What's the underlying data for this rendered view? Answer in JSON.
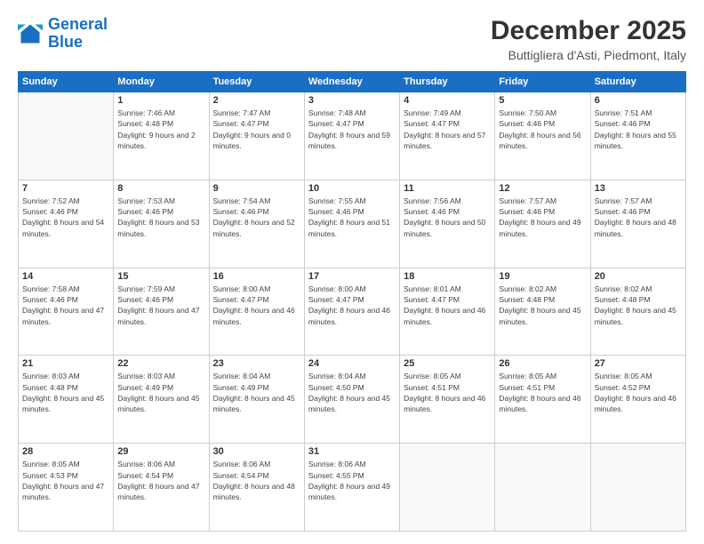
{
  "logo": {
    "line1": "General",
    "line2": "Blue"
  },
  "title": "December 2025",
  "subtitle": "Buttigliera d'Asti, Piedmont, Italy",
  "weekdays": [
    "Sunday",
    "Monday",
    "Tuesday",
    "Wednesday",
    "Thursday",
    "Friday",
    "Saturday"
  ],
  "weeks": [
    [
      {
        "day": "",
        "sunrise": "",
        "sunset": "",
        "daylight": ""
      },
      {
        "day": "1",
        "sunrise": "Sunrise: 7:46 AM",
        "sunset": "Sunset: 4:48 PM",
        "daylight": "Daylight: 9 hours and 2 minutes."
      },
      {
        "day": "2",
        "sunrise": "Sunrise: 7:47 AM",
        "sunset": "Sunset: 4:47 PM",
        "daylight": "Daylight: 9 hours and 0 minutes."
      },
      {
        "day": "3",
        "sunrise": "Sunrise: 7:48 AM",
        "sunset": "Sunset: 4:47 PM",
        "daylight": "Daylight: 8 hours and 59 minutes."
      },
      {
        "day": "4",
        "sunrise": "Sunrise: 7:49 AM",
        "sunset": "Sunset: 4:47 PM",
        "daylight": "Daylight: 8 hours and 57 minutes."
      },
      {
        "day": "5",
        "sunrise": "Sunrise: 7:50 AM",
        "sunset": "Sunset: 4:46 PM",
        "daylight": "Daylight: 8 hours and 56 minutes."
      },
      {
        "day": "6",
        "sunrise": "Sunrise: 7:51 AM",
        "sunset": "Sunset: 4:46 PM",
        "daylight": "Daylight: 8 hours and 55 minutes."
      }
    ],
    [
      {
        "day": "7",
        "sunrise": "Sunrise: 7:52 AM",
        "sunset": "Sunset: 4:46 PM",
        "daylight": "Daylight: 8 hours and 54 minutes."
      },
      {
        "day": "8",
        "sunrise": "Sunrise: 7:53 AM",
        "sunset": "Sunset: 4:46 PM",
        "daylight": "Daylight: 8 hours and 53 minutes."
      },
      {
        "day": "9",
        "sunrise": "Sunrise: 7:54 AM",
        "sunset": "Sunset: 4:46 PM",
        "daylight": "Daylight: 8 hours and 52 minutes."
      },
      {
        "day": "10",
        "sunrise": "Sunrise: 7:55 AM",
        "sunset": "Sunset: 4:46 PM",
        "daylight": "Daylight: 8 hours and 51 minutes."
      },
      {
        "day": "11",
        "sunrise": "Sunrise: 7:56 AM",
        "sunset": "Sunset: 4:46 PM",
        "daylight": "Daylight: 8 hours and 50 minutes."
      },
      {
        "day": "12",
        "sunrise": "Sunrise: 7:57 AM",
        "sunset": "Sunset: 4:46 PM",
        "daylight": "Daylight: 8 hours and 49 minutes."
      },
      {
        "day": "13",
        "sunrise": "Sunrise: 7:57 AM",
        "sunset": "Sunset: 4:46 PM",
        "daylight": "Daylight: 8 hours and 48 minutes."
      }
    ],
    [
      {
        "day": "14",
        "sunrise": "Sunrise: 7:58 AM",
        "sunset": "Sunset: 4:46 PM",
        "daylight": "Daylight: 8 hours and 47 minutes."
      },
      {
        "day": "15",
        "sunrise": "Sunrise: 7:59 AM",
        "sunset": "Sunset: 4:46 PM",
        "daylight": "Daylight: 8 hours and 47 minutes."
      },
      {
        "day": "16",
        "sunrise": "Sunrise: 8:00 AM",
        "sunset": "Sunset: 4:47 PM",
        "daylight": "Daylight: 8 hours and 46 minutes."
      },
      {
        "day": "17",
        "sunrise": "Sunrise: 8:00 AM",
        "sunset": "Sunset: 4:47 PM",
        "daylight": "Daylight: 8 hours and 46 minutes."
      },
      {
        "day": "18",
        "sunrise": "Sunrise: 8:01 AM",
        "sunset": "Sunset: 4:47 PM",
        "daylight": "Daylight: 8 hours and 46 minutes."
      },
      {
        "day": "19",
        "sunrise": "Sunrise: 8:02 AM",
        "sunset": "Sunset: 4:48 PM",
        "daylight": "Daylight: 8 hours and 45 minutes."
      },
      {
        "day": "20",
        "sunrise": "Sunrise: 8:02 AM",
        "sunset": "Sunset: 4:48 PM",
        "daylight": "Daylight: 8 hours and 45 minutes."
      }
    ],
    [
      {
        "day": "21",
        "sunrise": "Sunrise: 8:03 AM",
        "sunset": "Sunset: 4:48 PM",
        "daylight": "Daylight: 8 hours and 45 minutes."
      },
      {
        "day": "22",
        "sunrise": "Sunrise: 8:03 AM",
        "sunset": "Sunset: 4:49 PM",
        "daylight": "Daylight: 8 hours and 45 minutes."
      },
      {
        "day": "23",
        "sunrise": "Sunrise: 8:04 AM",
        "sunset": "Sunset: 4:49 PM",
        "daylight": "Daylight: 8 hours and 45 minutes."
      },
      {
        "day": "24",
        "sunrise": "Sunrise: 8:04 AM",
        "sunset": "Sunset: 4:50 PM",
        "daylight": "Daylight: 8 hours and 45 minutes."
      },
      {
        "day": "25",
        "sunrise": "Sunrise: 8:05 AM",
        "sunset": "Sunset: 4:51 PM",
        "daylight": "Daylight: 8 hours and 46 minutes."
      },
      {
        "day": "26",
        "sunrise": "Sunrise: 8:05 AM",
        "sunset": "Sunset: 4:51 PM",
        "daylight": "Daylight: 8 hours and 46 minutes."
      },
      {
        "day": "27",
        "sunrise": "Sunrise: 8:05 AM",
        "sunset": "Sunset: 4:52 PM",
        "daylight": "Daylight: 8 hours and 46 minutes."
      }
    ],
    [
      {
        "day": "28",
        "sunrise": "Sunrise: 8:05 AM",
        "sunset": "Sunset: 4:53 PM",
        "daylight": "Daylight: 8 hours and 47 minutes."
      },
      {
        "day": "29",
        "sunrise": "Sunrise: 8:06 AM",
        "sunset": "Sunset: 4:54 PM",
        "daylight": "Daylight: 8 hours and 47 minutes."
      },
      {
        "day": "30",
        "sunrise": "Sunrise: 8:06 AM",
        "sunset": "Sunset: 4:54 PM",
        "daylight": "Daylight: 8 hours and 48 minutes."
      },
      {
        "day": "31",
        "sunrise": "Sunrise: 8:06 AM",
        "sunset": "Sunset: 4:55 PM",
        "daylight": "Daylight: 8 hours and 49 minutes."
      },
      {
        "day": "",
        "sunrise": "",
        "sunset": "",
        "daylight": ""
      },
      {
        "day": "",
        "sunrise": "",
        "sunset": "",
        "daylight": ""
      },
      {
        "day": "",
        "sunrise": "",
        "sunset": "",
        "daylight": ""
      }
    ]
  ]
}
